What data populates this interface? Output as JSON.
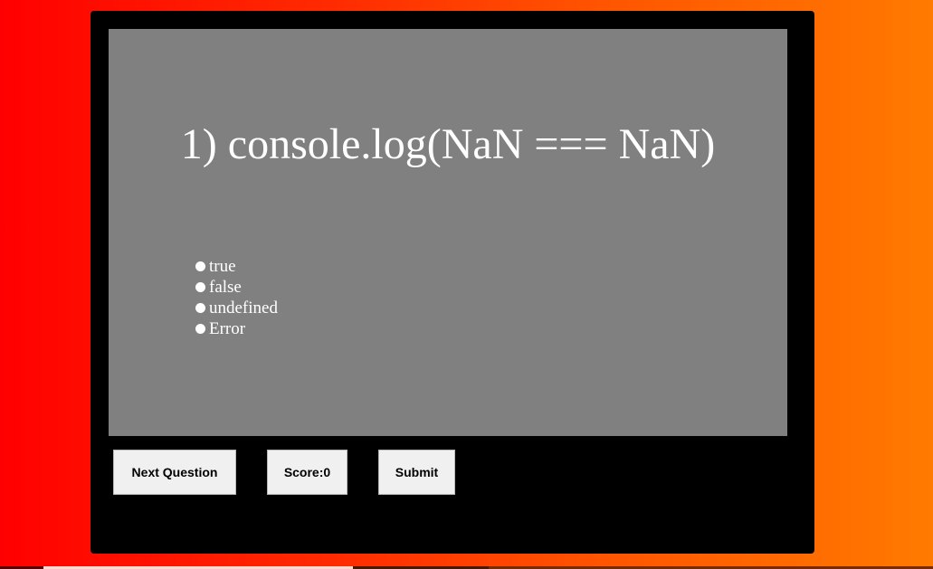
{
  "question": {
    "text": "1) console.log(NaN === NaN)"
  },
  "options": [
    {
      "label": "true"
    },
    {
      "label": "false"
    },
    {
      "label": "undefined"
    },
    {
      "label": "Error"
    }
  ],
  "buttons": {
    "next_label": "Next Question",
    "score_label": "Score:0",
    "submit_label": "Submit"
  },
  "colors": {
    "background_left": "#ff0000",
    "background_right": "#ff7a00",
    "panel": "#000000",
    "question_area": "#808080",
    "text": "#ffffff",
    "button": "#f0f0f0"
  }
}
